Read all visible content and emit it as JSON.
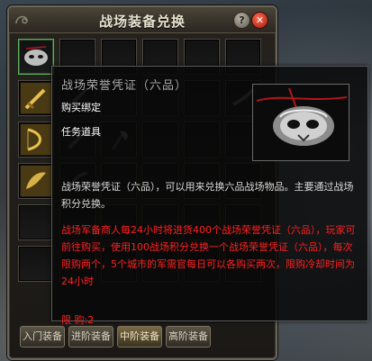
{
  "window": {
    "title": "战场装备兑换",
    "help_label": "?",
    "close_label": "✕"
  },
  "grid": {
    "rows": 6,
    "cols": 6,
    "slots": [
      {
        "icon": "silver-mask-icon",
        "selected": true
      },
      {
        "icon": ""
      },
      {
        "icon": ""
      },
      {
        "icon": ""
      },
      {
        "icon": ""
      },
      {
        "icon": ""
      },
      {
        "icon": "golden-sword-icon"
      },
      {
        "icon": "dark-dagger-icon"
      },
      {
        "icon": ""
      },
      {
        "icon": ""
      },
      {
        "icon": ""
      },
      {
        "icon": "dark-blade-icon"
      },
      {
        "icon": "golden-bow-icon"
      },
      {
        "icon": "dark-dagger-icon"
      },
      {
        "icon": "dark-axe-icon"
      },
      {
        "icon": ""
      },
      {
        "icon": ""
      },
      {
        "icon": ""
      },
      {
        "icon": "golden-wing-icon"
      },
      {
        "icon": "dark-claw-icon"
      },
      {
        "icon": ""
      },
      {
        "icon": ""
      },
      {
        "icon": ""
      },
      {
        "icon": ""
      },
      {
        "icon": ""
      },
      {
        "icon": ""
      },
      {
        "icon": ""
      },
      {
        "icon": ""
      },
      {
        "icon": ""
      },
      {
        "icon": ""
      },
      {
        "icon": ""
      },
      {
        "icon": ""
      },
      {
        "icon": ""
      },
      {
        "icon": ""
      },
      {
        "icon": ""
      },
      {
        "icon": ""
      }
    ]
  },
  "tabs": [
    {
      "label": "入门装备",
      "active": false
    },
    {
      "label": "进阶装备",
      "active": false
    },
    {
      "label": "中阶装备",
      "active": true
    },
    {
      "label": "高阶装备",
      "active": false
    }
  ],
  "tooltip": {
    "name": "战场荣誉凭证（六品）",
    "bind": "购买绑定",
    "type": "任务道具",
    "description": "战场荣誉凭证（六品），可以用来兑换六品战场物品。主要通过战场积分兑换。",
    "notice": "战场军备商人每24小时将进货400个战场荣誉凭证（六品），玩家可前往购买，使用100战场积分兑换一个战场荣誉凭证（六品），每次限购两个，5个城市的军需官每日可以各购买两次，限购冷却时间为24小时",
    "limit": "限 购:2",
    "preview_icon": "silver-mask-pendant-icon"
  }
}
